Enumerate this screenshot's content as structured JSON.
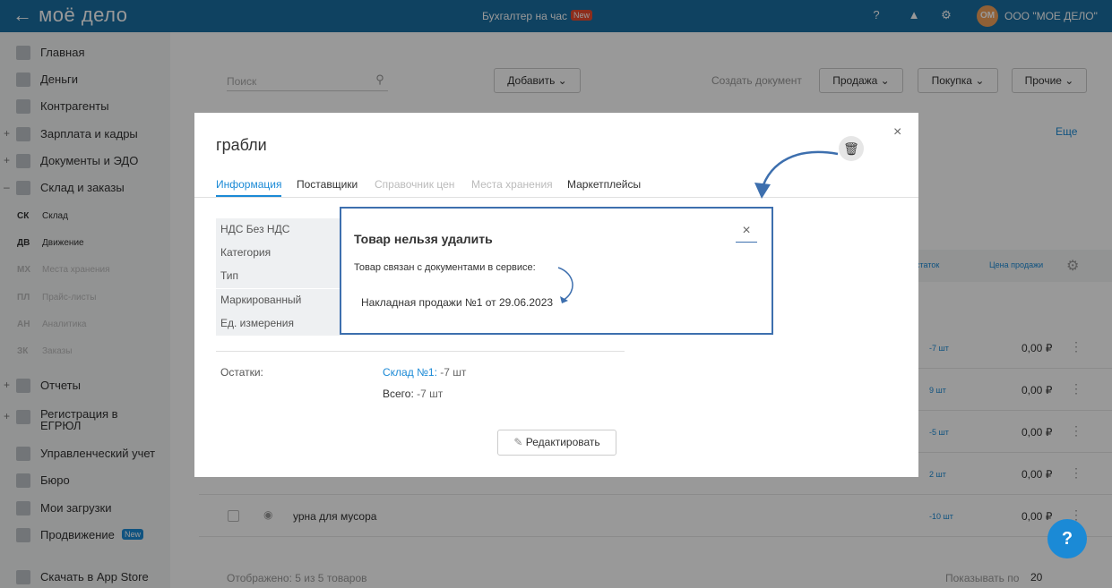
{
  "header": {
    "logo": "← моё дело",
    "center": "Бухгалтер на час",
    "badge": "New",
    "avatar": "ОМ",
    "company": "ООО \"МОЕ ДЕЛО\""
  },
  "sidebar": {
    "items": [
      "Главная",
      "Деньги",
      "Контрагенты",
      "Зарплата и кадры",
      "Документы и ЭДО",
      "Склад и заказы"
    ],
    "subs": [
      {
        "ab": "СК",
        "label": "Склад"
      },
      {
        "ab": "ДВ",
        "label": "Движение"
      },
      {
        "ab": "МХ",
        "label": "Места хранения"
      },
      {
        "ab": "ПЛ",
        "label": "Прайс-листы"
      },
      {
        "ab": "АН",
        "label": "Аналитика"
      },
      {
        "ab": "ЗК",
        "label": "Заказы"
      }
    ],
    "lower": [
      "Отчеты",
      "Регистрация в ЕГРЮЛ",
      "Управленческий учет",
      "Бюро",
      "Мои загрузки",
      "Продвижение"
    ],
    "promo_badge": "New",
    "app": "Скачать в App Store"
  },
  "toolbar": {
    "search": "Поиск",
    "add": "Добавить",
    "create": "Создать документ",
    "sale": "Продажа",
    "purchase": "Покупка",
    "other": "Прочие",
    "more": "Еще"
  },
  "table": {
    "h_stock": "статок",
    "h_price": "Цена продажи",
    "rows": [
      {
        "name": "",
        "stock": "-7 шт",
        "price": "0,00 ₽"
      },
      {
        "name": "",
        "stock": "9 шт",
        "price": "0,00 ₽"
      },
      {
        "name": "",
        "stock": "-5 шт",
        "price": "0,00 ₽"
      },
      {
        "name": "",
        "stock": "2 шт",
        "price": "0,00 ₽"
      },
      {
        "name": "урна для мусора",
        "stock": "-10 шт",
        "price": "0,00 ₽"
      }
    ]
  },
  "footer": {
    "shown": "Отображено: 5 из 5 товаров",
    "perpage": "Показывать по",
    "perpage_val": "20"
  },
  "modal": {
    "title": "грабли",
    "tabs": [
      "Информация",
      "Поставщики",
      "Справочник цен",
      "Места хранения",
      "Маркетплейсы"
    ],
    "props": [
      "НДС Без НДС",
      "Категория",
      "Тип",
      "Маркированный",
      "Ед. измерения"
    ],
    "stock_label": "Остатки:",
    "warehouse": "Склад №1:",
    "warehouse_qty": "-7 шт",
    "total_label": "Всего:",
    "total_qty": "-7 шт",
    "edit": "Редактировать"
  },
  "popup": {
    "title": "Товар нельзя удалить",
    "text": "Товар связан с документами в сервисе:",
    "doc": "Накладная продажи №1 от 29.06.2023"
  }
}
